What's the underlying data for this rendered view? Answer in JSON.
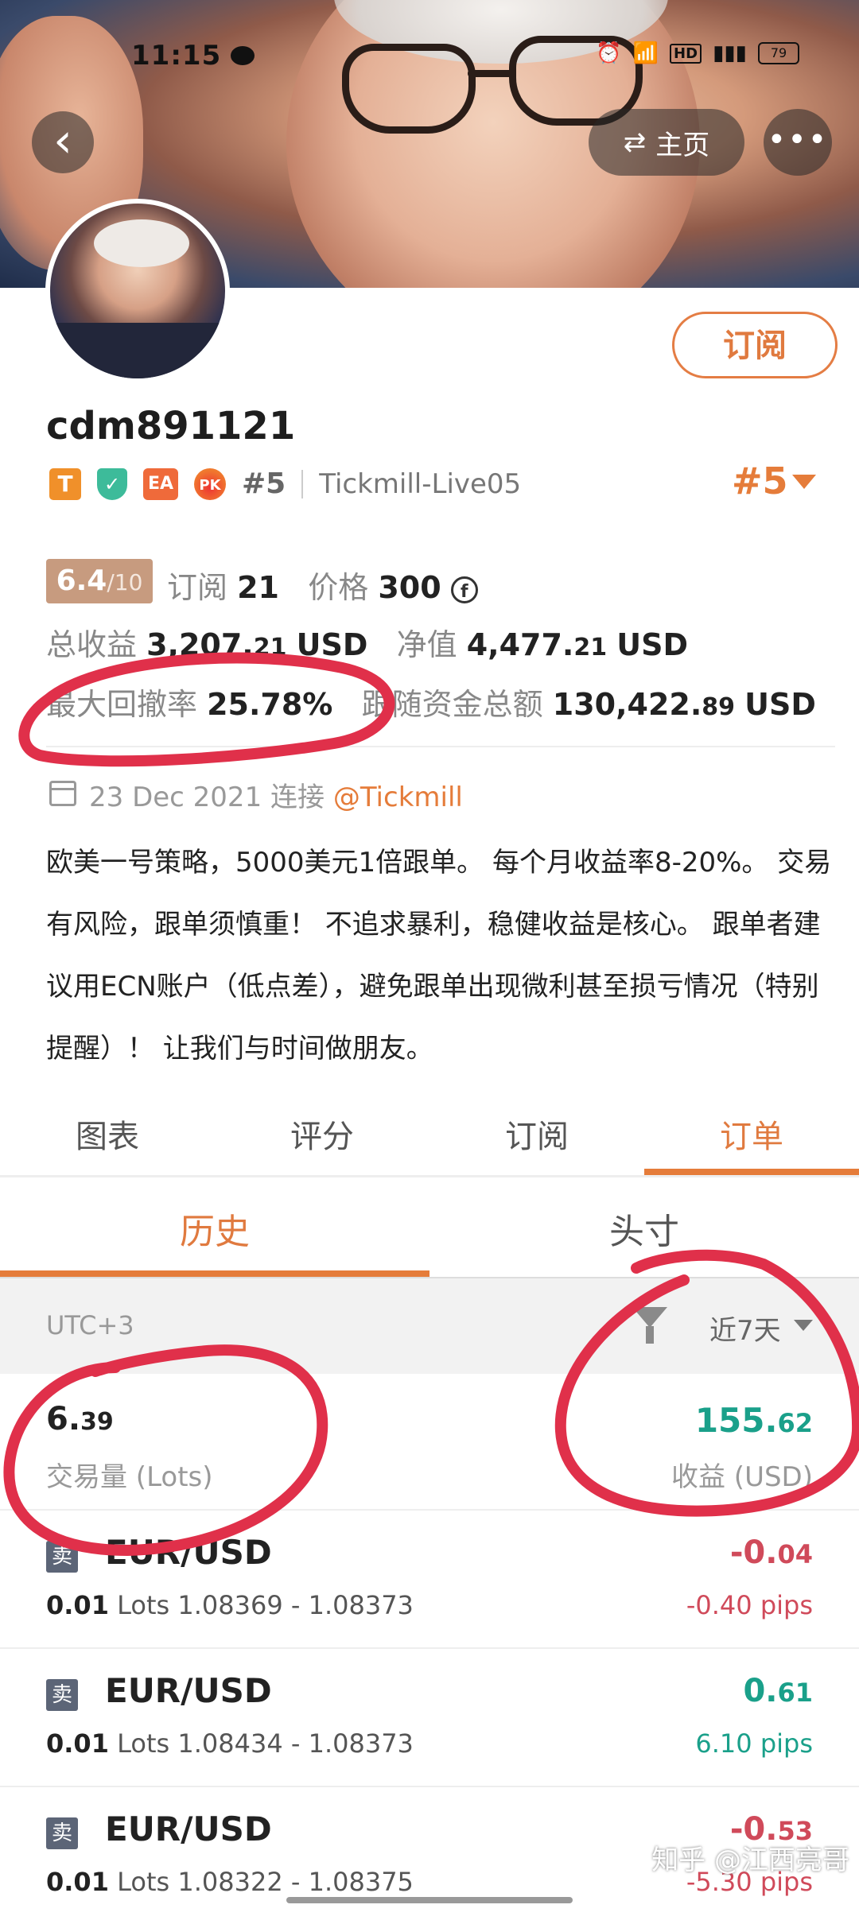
{
  "status": {
    "time": "11:15",
    "battery": "79",
    "hd": "HD"
  },
  "nav": {
    "back_icon": "‹",
    "home_label": "主页",
    "more_icon": "•••"
  },
  "profile": {
    "subscribe_label": "订阅",
    "username": "cdm891121",
    "badges": [
      "T",
      "EA",
      "PK"
    ],
    "rank_small": "#5",
    "server": "Tickmill-Live05",
    "rank_big": "#5"
  },
  "stats": {
    "score": "6.4",
    "score_den": "/10",
    "subscribers_label": "订阅",
    "subscribers": "21",
    "price_label": "价格",
    "price": "300",
    "price_icon": "f",
    "total_profit_label": "总收益",
    "total_profit_int": "3,207.",
    "total_profit_dec": "21",
    "currency": "USD",
    "equity_label": "净值",
    "equity_int": "4,477.",
    "equity_dec": "21",
    "max_drawdown_label": "最大回撤率",
    "max_drawdown": "25.78%",
    "follow_funds_label": "跟随资金总额",
    "follow_funds_int": "130,422.",
    "follow_funds_dec": "89"
  },
  "join": {
    "date": "23 Dec 2021",
    "connect_label": "连接",
    "broker": "@Tickmill"
  },
  "description": "欧美一号策略，5000美元1倍跟单。 每个月收益率8-20%。 交易有风险，跟单须慎重！ 不追求暴利，稳健收益是核心。 跟单者建议用ECN账户（低点差），避免跟单出现微利甚至损亏情况（特别提醒）！ 让我们与时间做朋友。",
  "tabs": [
    "图表",
    "评分",
    "订阅",
    "订单"
  ],
  "subtabs": [
    "历史",
    "头寸"
  ],
  "filter": {
    "timezone": "UTC+3",
    "range": "近7天"
  },
  "summary": {
    "volume_int": "6.",
    "volume_dec": "39",
    "volume_label": "交易量 (Lots)",
    "profit_int": "155.",
    "profit_dec": "62",
    "profit_label": "收益 (USD)"
  },
  "orders": [
    {
      "side": "卖",
      "pair": "EUR/USD",
      "lots": "0.01",
      "lots_unit": "Lots",
      "prices": "1.08369 - 1.08373",
      "pnl_int": "-0.",
      "pnl_dec": "04",
      "pips": "-0.40 pips",
      "sign": "neg"
    },
    {
      "side": "卖",
      "pair": "EUR/USD",
      "lots": "0.01",
      "lots_unit": "Lots",
      "prices": "1.08434 - 1.08373",
      "pnl_int": "0.",
      "pnl_dec": "61",
      "pips": "6.10 pips",
      "sign": "pos"
    },
    {
      "side": "卖",
      "pair": "EUR/USD",
      "lots": "0.01",
      "lots_unit": "Lots",
      "prices": "1.08322 - 1.08375",
      "pnl_int": "-0.",
      "pnl_dec": "53",
      "pips": "-5.30 pips",
      "sign": "neg"
    }
  ],
  "watermark": "知乎 @江西亮哥",
  "colors": {
    "accent": "#e57c3a",
    "positive": "#1aa08a",
    "negative": "#d04a5a",
    "annotation": "#e0304a"
  }
}
